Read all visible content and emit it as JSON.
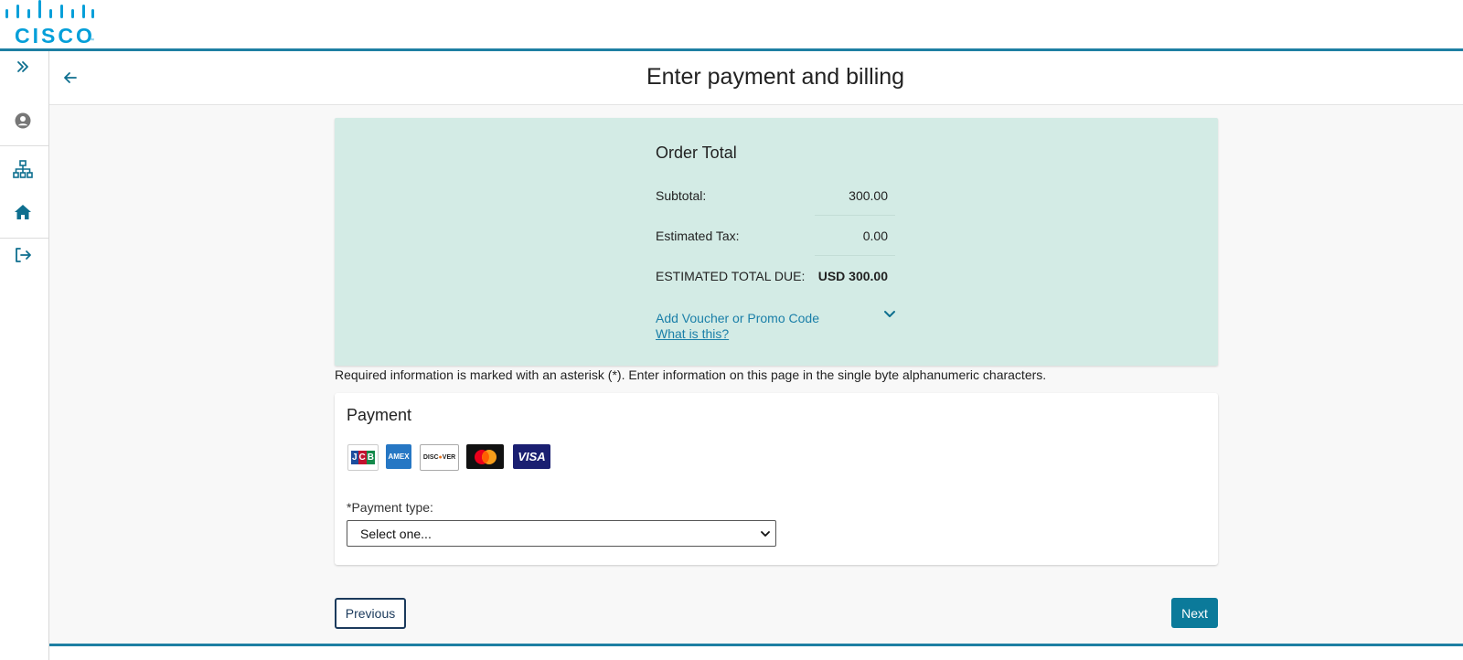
{
  "brand": {
    "name": "CISCO",
    "tm": "™",
    "color": "#049fd9"
  },
  "sidebar": {
    "items": [
      {
        "icon": "expand-double-chevron-icon"
      },
      {
        "icon": "user-circle-icon"
      },
      {
        "icon": "org-chart-icon"
      },
      {
        "icon": "home-icon"
      },
      {
        "icon": "sign-out-icon"
      }
    ]
  },
  "header": {
    "title": "Enter payment and billing",
    "back_icon": "arrow-left-icon"
  },
  "order": {
    "title": "Order Total",
    "rows": [
      {
        "label": "Subtotal:",
        "value": "300.00"
      },
      {
        "label": "Estimated Tax:",
        "value": "0.00"
      },
      {
        "label": "ESTIMATED TOTAL DUE:",
        "value": "USD 300.00"
      }
    ],
    "voucher_link": "Add Voucher or Promo Code",
    "what_link": "What is this?"
  },
  "note": "Required information is marked with an asterisk (*). Enter information on this page in the single byte alphanumeric characters.",
  "payment": {
    "title": "Payment",
    "cards": [
      {
        "name": "JCB",
        "icon": "jcb-card-icon"
      },
      {
        "name": "AMEX",
        "icon": "amex-card-icon"
      },
      {
        "name": "DISCOVER",
        "icon": "discover-card-icon"
      },
      {
        "name": "mastercard",
        "icon": "mastercard-card-icon"
      },
      {
        "name": "VISA",
        "icon": "visa-card-icon"
      }
    ],
    "type_label": "*Payment type:",
    "type_value": "Select one..."
  },
  "buttons": {
    "previous": "Previous",
    "next": "Next"
  },
  "colors": {
    "accent": "#1e7fa3",
    "order_bg": "#d3ebe5",
    "next_bg": "#0b7a9a",
    "link": "#1a7fa8"
  }
}
